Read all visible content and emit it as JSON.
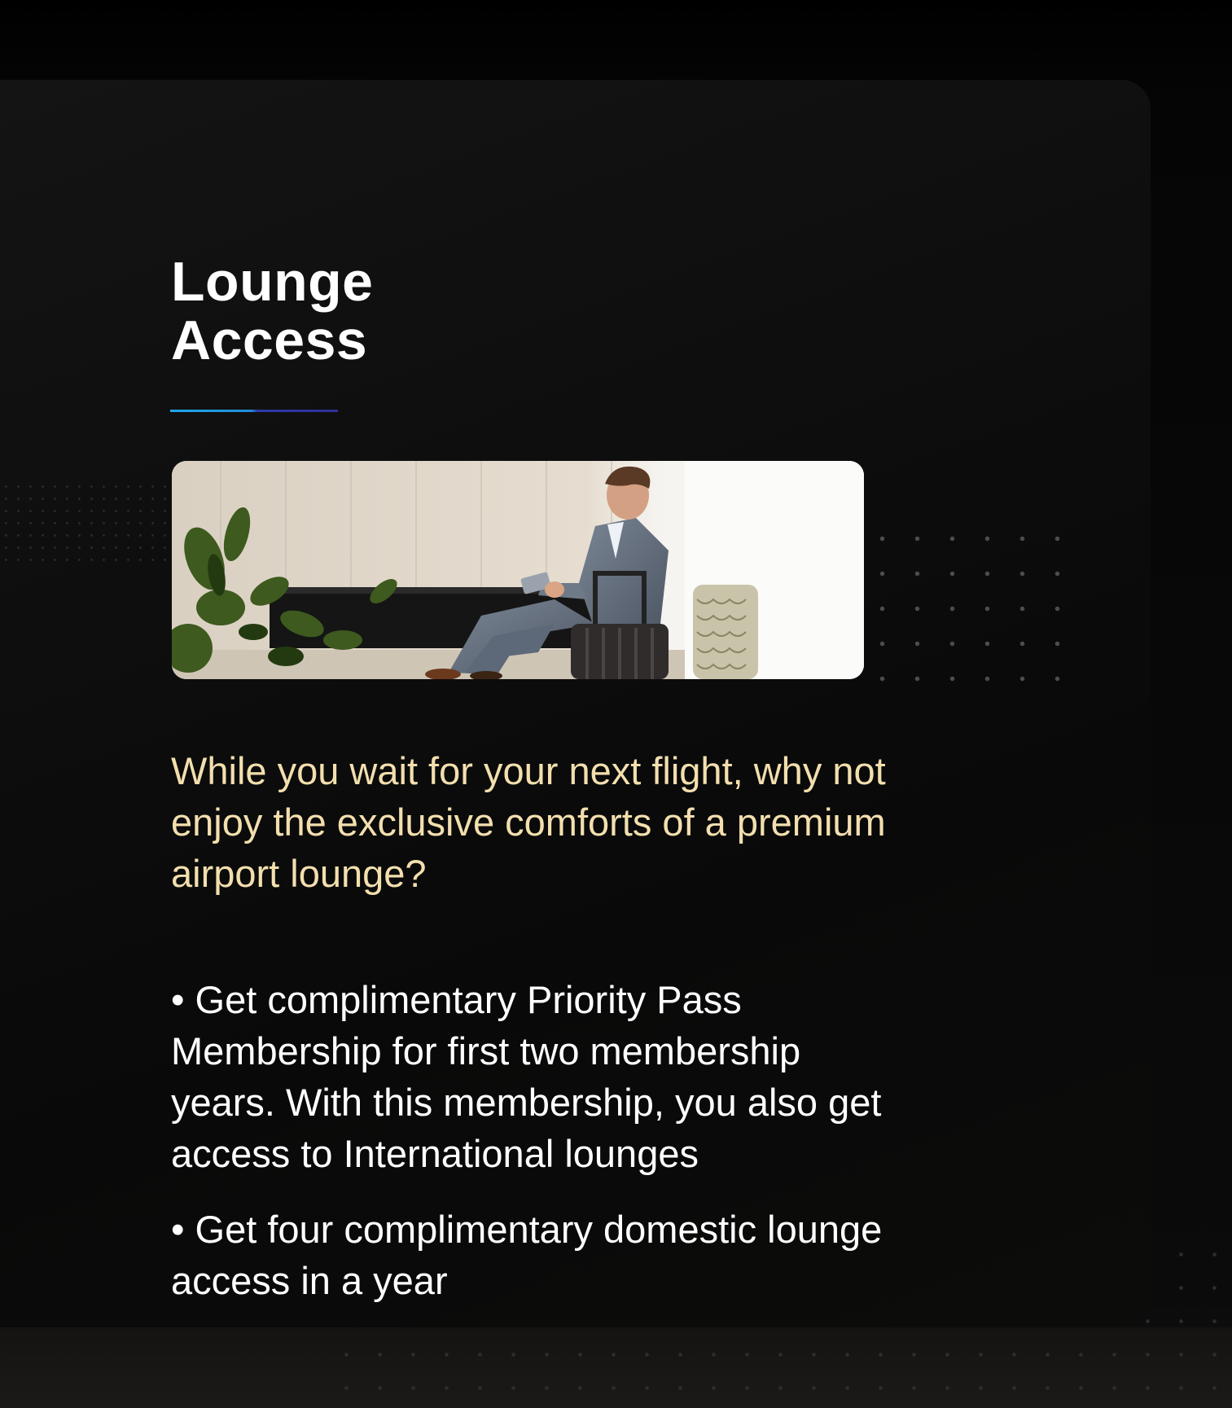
{
  "section": {
    "title_line1": "Lounge",
    "title_line2": "Access"
  },
  "hero_image": {
    "description_icon": "lounge-photo"
  },
  "intro_text": "While you wait for your next flight, why not enjoy the exclusive comforts of a premium airport lounge?",
  "benefits": [
    "• Get complimentary Priority Pass Membership for first two membership years. With this membership, you also get access to International lounges",
    "• Get four complimentary domestic lounge access in a year"
  ],
  "colors": {
    "title": "#ffffff",
    "intro": "#f3dfae",
    "accent_blue": "#1fa6e8",
    "accent_indigo": "#2f2f9a"
  }
}
